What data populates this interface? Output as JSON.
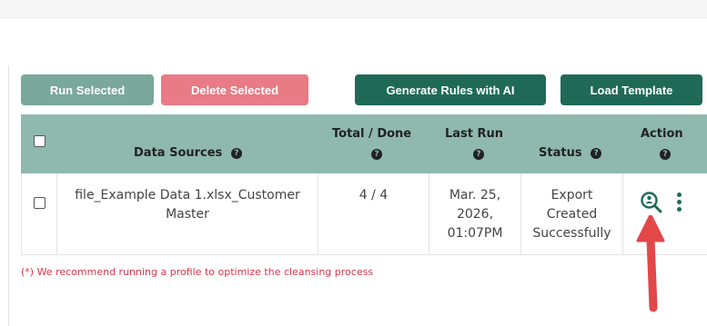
{
  "toolbar": {
    "run_selected": "Run Selected",
    "delete_selected": "Delete Selected",
    "generate_rules": "Generate Rules with AI",
    "load_template": "Load Template"
  },
  "table": {
    "headers": {
      "data_sources": "Data Sources",
      "total_done_1": "Total / Done",
      "last_run": "Last Run",
      "status": "Status",
      "action": "Action"
    },
    "help_glyph": "?",
    "rows": [
      {
        "data_source_line1": "file_Example Data 1.xlsx_Customer",
        "data_source_line2": "Master",
        "total_done": "4 / 4",
        "last_run_line1": "Mar. 25,",
        "last_run_line2": "2026,",
        "last_run_line3": "01:07PM",
        "status_line1": "Export",
        "status_line2": "Created",
        "status_line3": "Successfully",
        "action_icons": [
          "view-details-icon",
          "more-vertical-icon"
        ]
      }
    ]
  },
  "note": "(*) We recommend running a profile to optimize the cleansing process",
  "colors": {
    "header_bg": "#8fb9ad",
    "primary_button": "#1f6a57",
    "run_button": "#7aa89b",
    "delete_button": "#e87b85",
    "note_text": "#d9364a",
    "arrow": "#e2474a"
  }
}
